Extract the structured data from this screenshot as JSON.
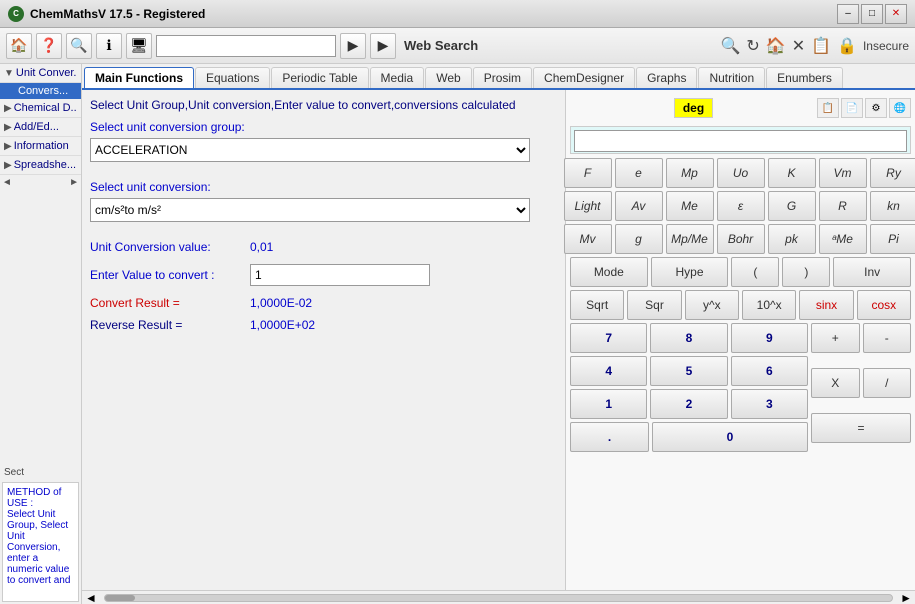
{
  "titleBar": {
    "title": "ChemMathsV 17.5 - Registered",
    "minLabel": "–",
    "maxLabel": "□",
    "closeLabel": "✕"
  },
  "toolbar": {
    "searchPlaceholder": "",
    "webSearchLabel": "Web Search",
    "insecureLabel": "Insecure"
  },
  "tabs": [
    {
      "label": "Main Functions",
      "active": true
    },
    {
      "label": "Equations"
    },
    {
      "label": "Periodic Table"
    },
    {
      "label": "Media"
    },
    {
      "label": "Web"
    },
    {
      "label": "Prosim"
    },
    {
      "label": "ChemDesigner"
    },
    {
      "label": "Graphs"
    },
    {
      "label": "Nutrition"
    },
    {
      "label": "Enumbers"
    }
  ],
  "sidebar": {
    "items": [
      {
        "label": "Unit Conver...",
        "expanded": true,
        "indent": 0
      },
      {
        "label": "Convers...",
        "selected": true,
        "indent": 1
      },
      {
        "label": "Chemical D...",
        "indent": 0
      },
      {
        "label": "Add/Ed...",
        "indent": 0
      },
      {
        "label": "Information",
        "indent": 0
      },
      {
        "label": "Spreadshe...",
        "indent": 0
      }
    ],
    "scrollLeft": "◄",
    "scrollRight": "►",
    "bottomSectionLabel": "Sect",
    "methodText": "METHOD of USE :\nSelect Unit Group, Select Unit Conversion, enter a numeric value to convert and"
  },
  "mainFunctions": {
    "infoText": "Select Unit Group,Unit conversion,Enter value to convert,conversions calculated",
    "degBadge": "deg",
    "selectGroupLabel": "Select unit conversion group:",
    "selectedGroup": "ACCELERATION",
    "selectConversionLabel": "Select unit conversion:",
    "selectedConversion": "cm/s²to  m/s²",
    "unitConversionLabel": "Unit Conversion value:",
    "unitConversionValue": "0,01",
    "enterValueLabel": "Enter Value to convert :",
    "enterValue": "1",
    "convertResultLabel": "Convert Result =",
    "convertResultValue": "1,0000E-02",
    "reverseResultLabel": "Reverse Result =",
    "reverseResultValue": "1,0000E+02"
  },
  "calculator": {
    "buttons": {
      "row1": [
        "F",
        "e",
        "Mp",
        "Uo",
        "K",
        "Vm",
        "Ry"
      ],
      "row2": [
        "Light",
        "Av",
        "Me",
        "ε",
        "G",
        "R",
        "kn"
      ],
      "row3": [
        "Mv",
        "g",
        "Mp/Me",
        "Bohr",
        "pk",
        "ᵃMe",
        "Pi"
      ],
      "row4": [
        "Mode",
        "Hype",
        "(",
        ")",
        "Inv"
      ],
      "row5": [
        "Sqrt",
        "Sqr",
        "y^x",
        "10^x",
        "sinx",
        "cosx"
      ],
      "numpad": [
        "7",
        "8",
        "9",
        "4",
        "5",
        "6",
        "1",
        "2",
        "3",
        ".",
        "0"
      ],
      "ops": [
        "+",
        "-",
        "X",
        "/",
        "="
      ]
    }
  }
}
